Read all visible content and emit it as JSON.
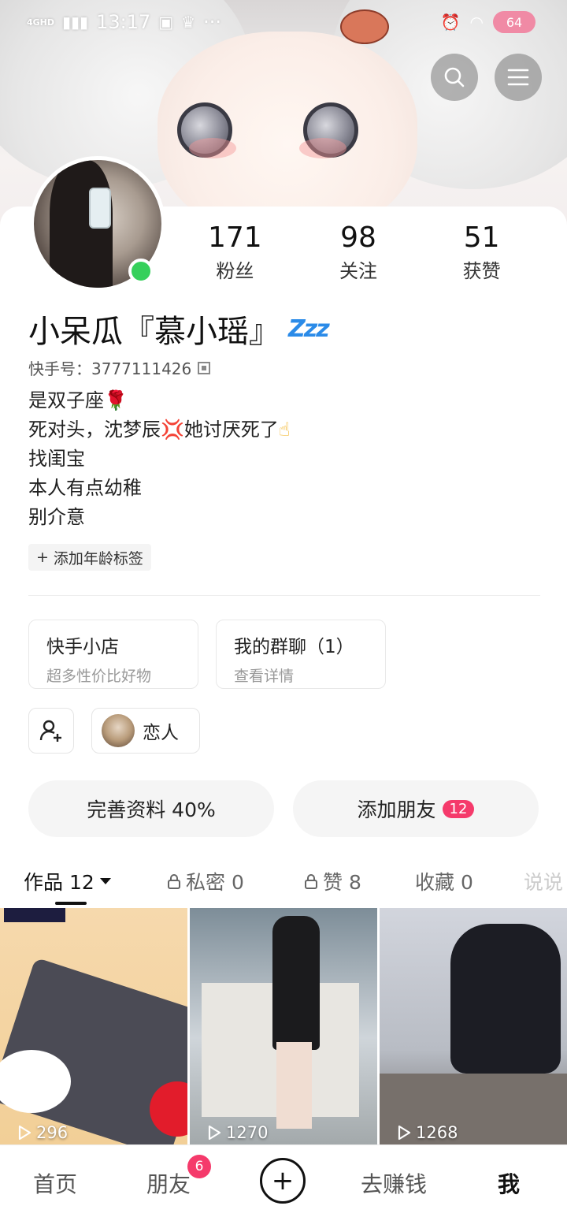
{
  "status_bar": {
    "time": "13:17",
    "network": "4GHD",
    "battery": "64",
    "more": "···"
  },
  "header": {
    "search_icon": "search-icon",
    "menu_icon": "menu-icon"
  },
  "profile": {
    "nickname": "小呆瓜『慕小瑶』",
    "id_label": "快手号：3777111426",
    "online": true,
    "stats": [
      {
        "num": "171",
        "label": "粉丝"
      },
      {
        "num": "98",
        "label": "关注"
      },
      {
        "num": "51",
        "label": "获赞"
      }
    ],
    "bio": [
      "是双子座",
      "死对头，沈梦辰",
      "她讨厌死了",
      "找闺宝",
      "本人有点幼稚",
      "别介意"
    ],
    "age_tag": "添加年龄标签"
  },
  "cards": {
    "shop_title": "快手小店",
    "shop_sub": "超多性价比好物",
    "group_title": "我的群聊（1）",
    "group_sub": "查看详情",
    "lover_label": "恋人"
  },
  "actions": {
    "complete_profile": "完善资料 40%",
    "add_friends": "添加朋友",
    "add_friends_badge": "12"
  },
  "tabs": {
    "works": "作品 12",
    "private": "私密 0",
    "likes": "赞 8",
    "favorites": "收藏 0",
    "more": "说说"
  },
  "grid": [
    {
      "plays": "296"
    },
    {
      "plays": "1270"
    },
    {
      "plays": "1268"
    }
  ],
  "nav": {
    "home": "首页",
    "friends": "朋友",
    "friends_badge": "6",
    "plus": "+",
    "earn": "去赚钱",
    "me": "我"
  }
}
